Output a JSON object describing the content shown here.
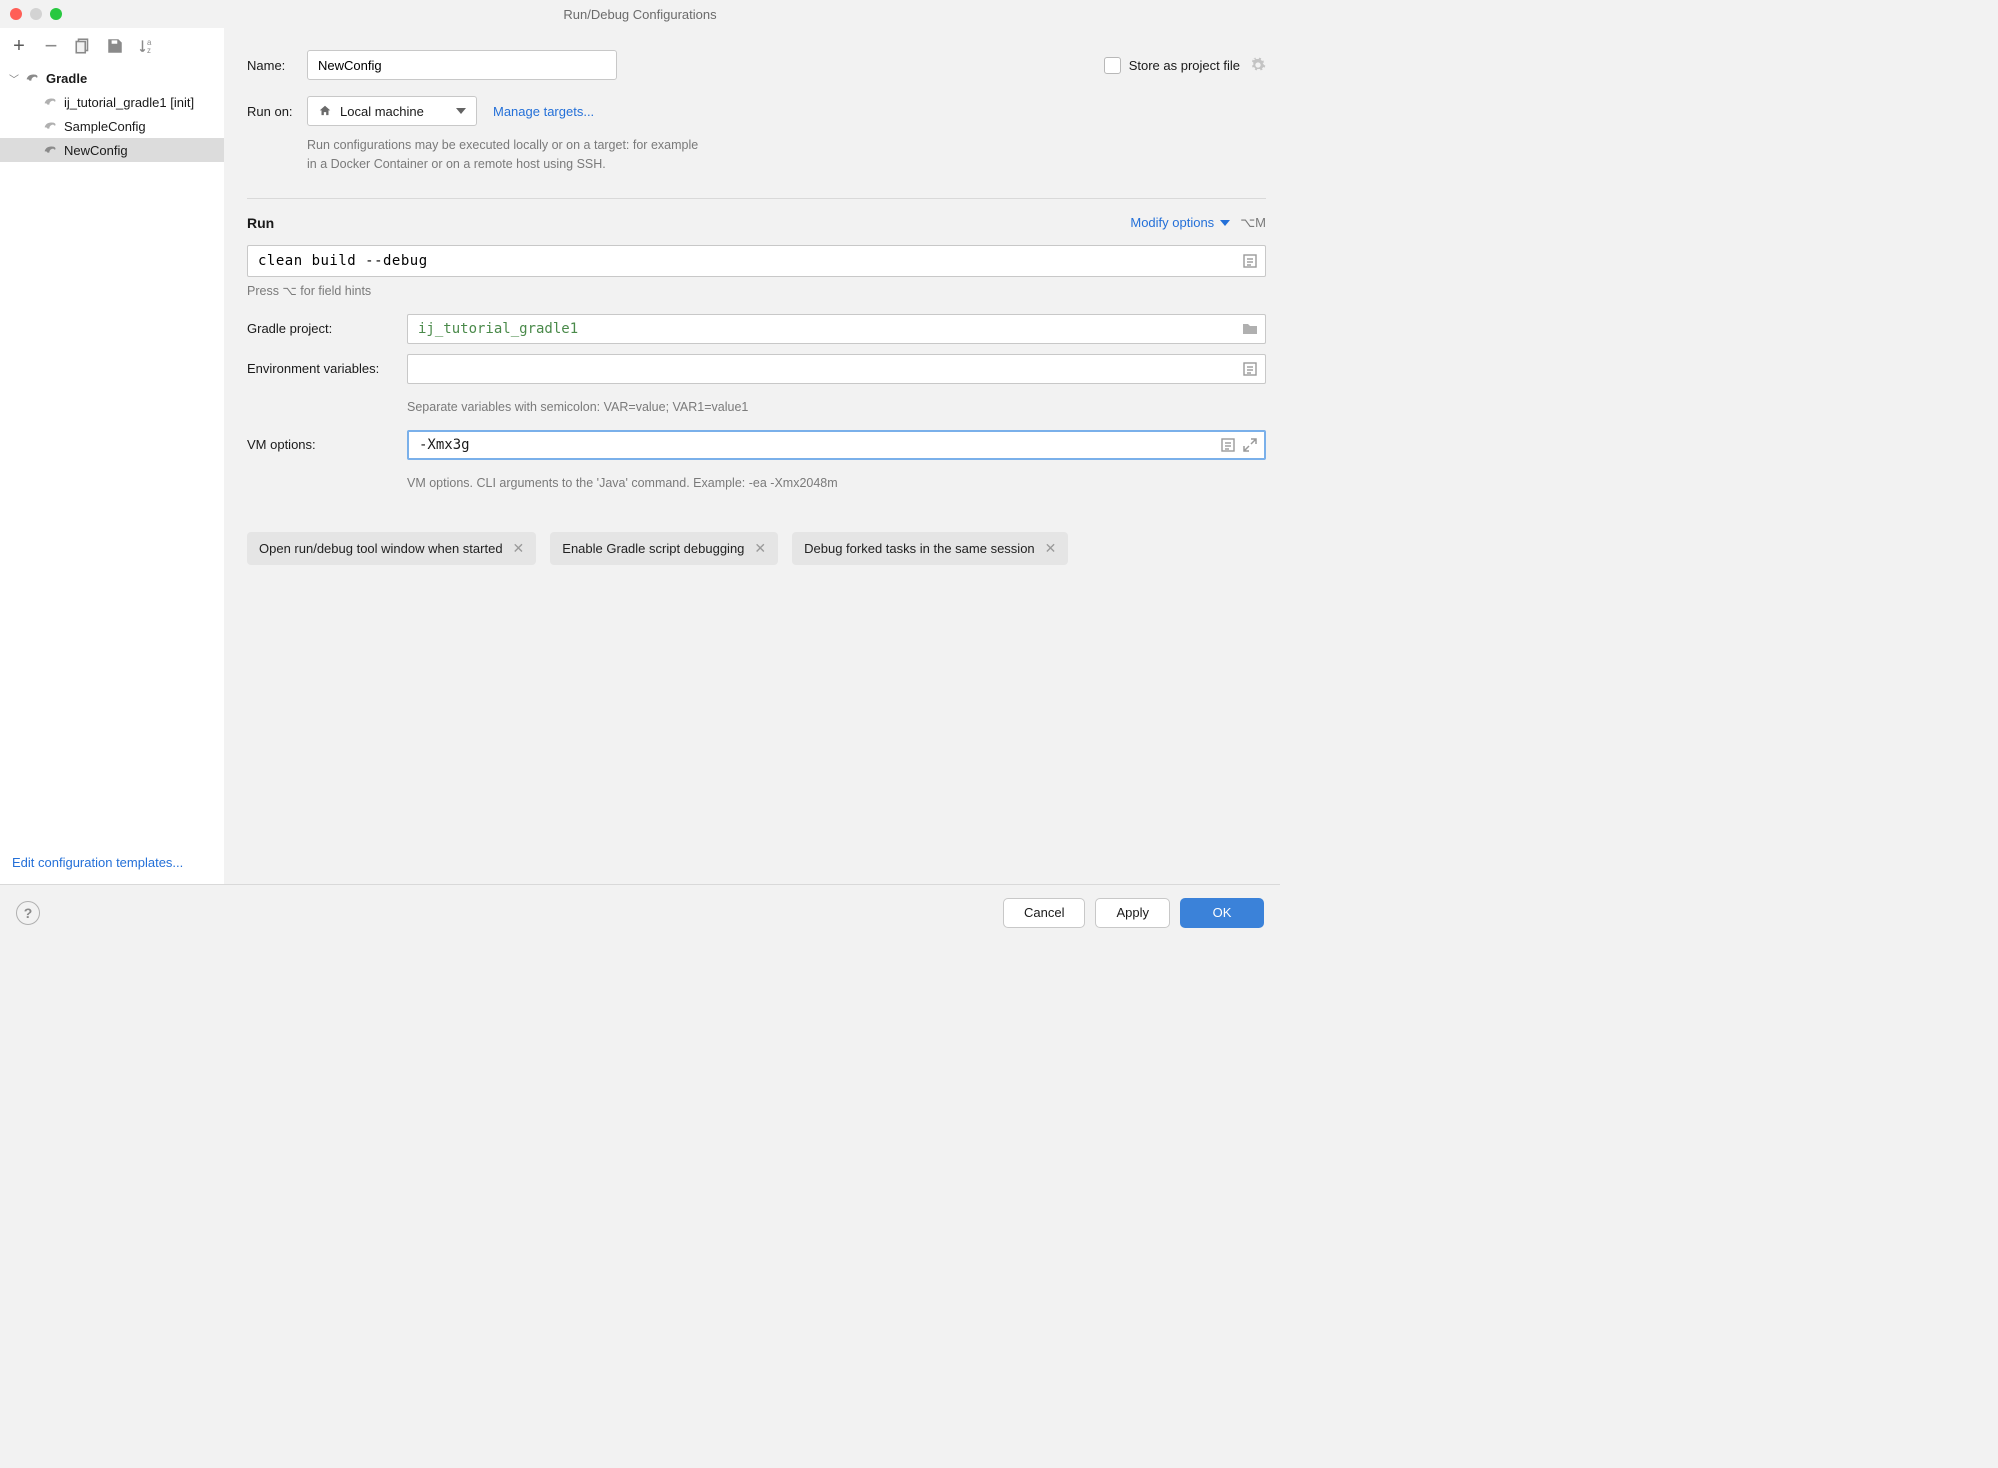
{
  "title": "Run/Debug Configurations",
  "tree": {
    "root_label": "Gradle",
    "items": [
      {
        "label": "ij_tutorial_gradle1 [init]"
      },
      {
        "label": "SampleConfig"
      },
      {
        "label": "NewConfig",
        "selected": true
      }
    ]
  },
  "sidebar_footer_link": "Edit configuration templates...",
  "form": {
    "name_label": "Name:",
    "name_value": "NewConfig",
    "store_label": "Store as project file",
    "runon_label": "Run on:",
    "runon_value": "Local machine",
    "manage_link": "Manage targets...",
    "runon_help1": "Run configurations may be executed locally or on a target: for example",
    "runon_help2": "in a Docker Container or on a remote host using SSH."
  },
  "run": {
    "section_title": "Run",
    "modify_label": "Modify options",
    "modify_shortcut": "⌥M",
    "command": "clean build --debug",
    "command_hint": "Press ⌥ for field hints",
    "gradle_label": "Gradle project:",
    "gradle_value": "ij_tutorial_gradle1",
    "env_label": "Environment variables:",
    "env_value": "",
    "env_hint": "Separate variables with semicolon: VAR=value; VAR1=value1",
    "vm_label": "VM options:",
    "vm_value": "-Xmx3g",
    "vm_hint": "VM options. CLI arguments to the 'Java' command. Example: -ea -Xmx2048m"
  },
  "chips": [
    "Open run/debug tool window when started",
    "Enable Gradle script debugging",
    "Debug forked tasks in the same session"
  ],
  "footer": {
    "cancel": "Cancel",
    "apply": "Apply",
    "ok": "OK"
  }
}
